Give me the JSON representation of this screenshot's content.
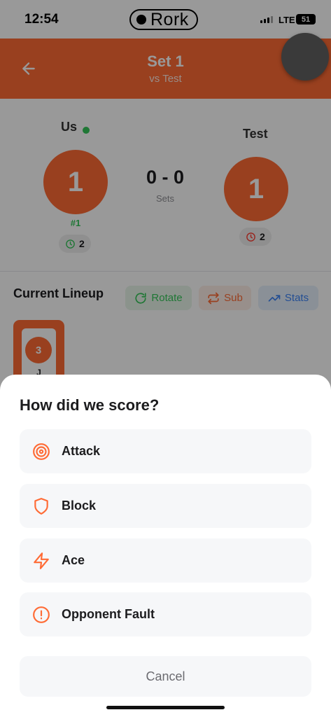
{
  "status_bar": {
    "time": "12:54",
    "app_pill": "Rork",
    "network": "LTE",
    "battery": "51"
  },
  "header": {
    "title": "Set 1",
    "subtitle": "vs Test"
  },
  "scoreboard": {
    "home": {
      "name": "Us",
      "score": "1",
      "rank": "#1",
      "timeouts": "2"
    },
    "away": {
      "name": "Test",
      "score": "1",
      "timeouts": "2"
    },
    "sets_score": "0 - 0",
    "sets_label": "Sets"
  },
  "lineup": {
    "title": "Current Lineup",
    "rotate_label": "Rotate",
    "sub_label": "Sub",
    "stats_label": "Stats",
    "players": [
      {
        "number": "3",
        "initial": "J"
      }
    ]
  },
  "score_sheet": {
    "title": "How did we score?",
    "options": [
      {
        "label": "Attack",
        "icon": "target-icon"
      },
      {
        "label": "Block",
        "icon": "shield-icon"
      },
      {
        "label": "Ace",
        "icon": "lightning-icon"
      },
      {
        "label": "Opponent Fault",
        "icon": "alert-circle-icon"
      }
    ],
    "cancel_label": "Cancel"
  },
  "colors": {
    "accent": "#ff6b35",
    "green": "#34c759",
    "blue": "#3b82f6",
    "red": "#ff3b30"
  }
}
